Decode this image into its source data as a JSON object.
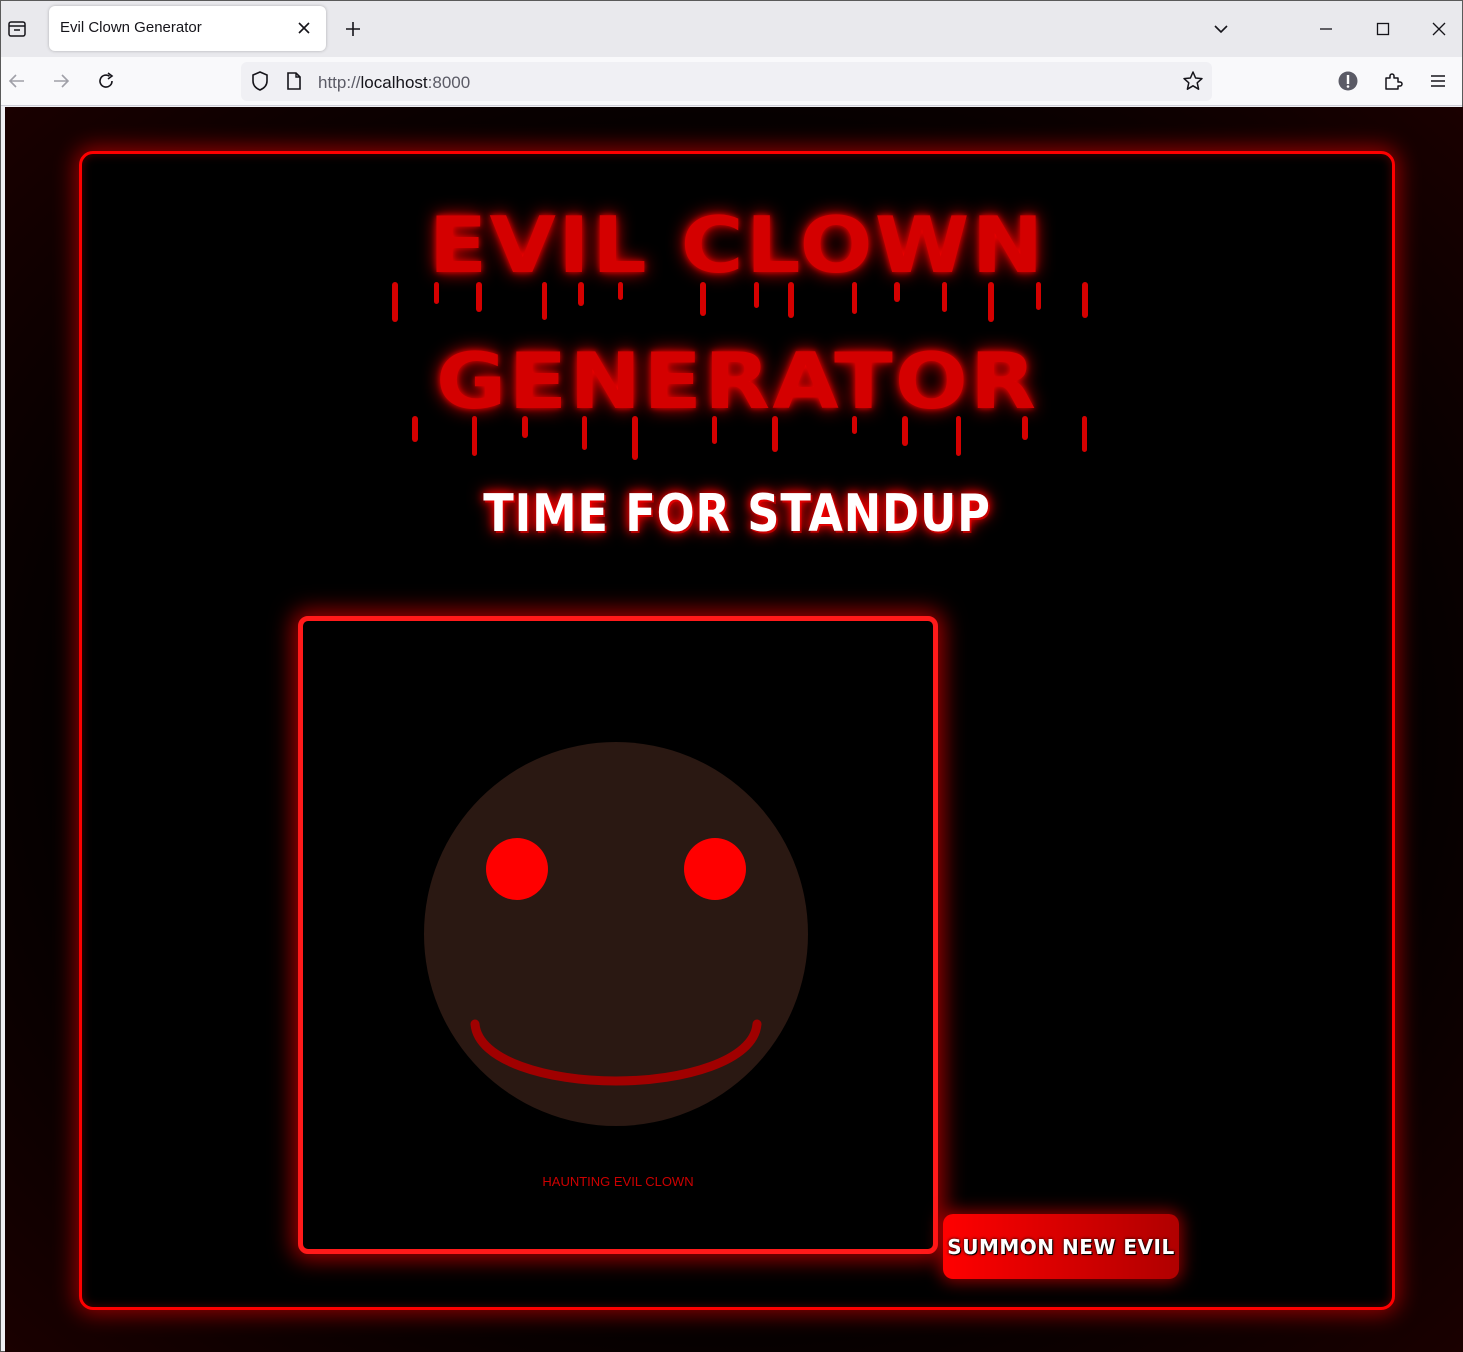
{
  "browser": {
    "tab_title": "Evil Clown Generator",
    "url_scheme": "http://",
    "url_host": "localhost",
    "url_port": ":8000"
  },
  "page": {
    "title_line1": "EVIL CLOWN",
    "title_line2": "GENERATOR",
    "subtitle": "TIME FOR STANDUP",
    "clown_caption": "HAUNTING EVIL CLOWN",
    "summon_button": "SUMMON NEW EVIL"
  },
  "colors": {
    "accent": "#ff0000",
    "title_red": "#d40000",
    "face": "#2a1812",
    "eyes": "#ff0000",
    "mouth": "#a00000",
    "background": "#000000"
  }
}
